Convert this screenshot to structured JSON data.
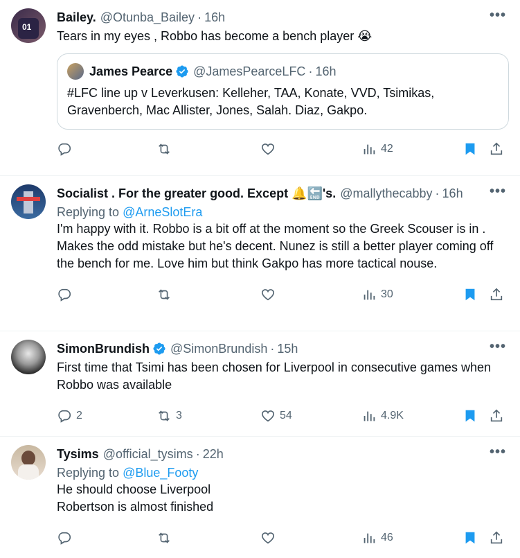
{
  "tweets": [
    {
      "name": "Bailey.",
      "handle": "@Otunba_Bailey",
      "dot": "·",
      "time": "16h",
      "text": "Tears in my eyes , Robbo has become a bench player 😭",
      "quote": {
        "name": "James Pearce",
        "handle": "@JamesPearceLFC",
        "dot": "·",
        "time": "16h",
        "text": "#LFC line up v Leverkusen: Kelleher, TAA, Konate, VVD, Tsimikas, Gravenberch, Mac Allister, Jones, Salah. Diaz, Gakpo."
      },
      "stats": {
        "replies": "",
        "retweets": "",
        "likes": "",
        "views": "42"
      }
    },
    {
      "name": "Socialist . For the greater good. Except 🔔🔚's.",
      "handle": "@mallythecabby",
      "dot": "·",
      "time": "16h",
      "replying_prefix": "Replying to ",
      "replying_to": "@ArneSlotEra",
      "text": "I'm happy with it.  Robbo is a bit off at the moment so the Greek Scouser is in . Makes the odd mistake but he's decent.  Nunez is still a better player coming off the bench for me.  Love him but think Gakpo has more tactical nouse.",
      "stats": {
        "replies": "",
        "retweets": "",
        "likes": "",
        "views": "30"
      }
    },
    {
      "name": "SimonBrundish",
      "handle": "@SimonBrundish",
      "dot": "·",
      "time": "15h",
      "text": "First time that Tsimi has been chosen for Liverpool in consecutive games when Robbo was available",
      "stats": {
        "replies": "2",
        "retweets": "3",
        "likes": "54",
        "views": "4.9K"
      }
    },
    {
      "name": "Tysims",
      "handle": "@official_tysims",
      "dot": "·",
      "time": "22h",
      "replying_prefix": "Replying to ",
      "replying_to": "@Blue_Footy",
      "text_lines": [
        "He should choose Liverpool",
        "Robertson is almost finished"
      ],
      "stats": {
        "replies": "",
        "retweets": "",
        "likes": "",
        "views": "46"
      }
    }
  ],
  "more_label": "•••",
  "colors": {
    "accent": "#1d9bf0",
    "muted": "#536471",
    "text": "#0f1419",
    "border": "#eff3f4"
  },
  "icons": [
    "reply-icon",
    "retweet-icon",
    "like-icon",
    "views-icon",
    "bookmark-icon",
    "share-icon",
    "verified-icon",
    "more-icon"
  ]
}
